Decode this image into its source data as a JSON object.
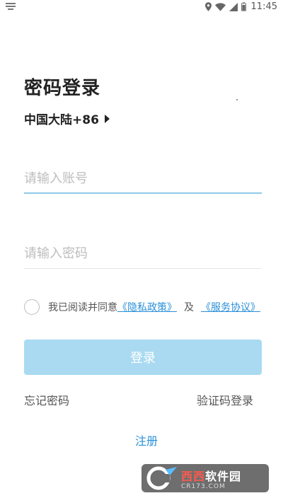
{
  "status_bar": {
    "time": "11:45",
    "icons": [
      "notification-icon",
      "location-icon",
      "wifi-icon",
      "signal-icon",
      "battery-icon"
    ]
  },
  "login": {
    "title": "密码登录",
    "region": "中国大陆+86",
    "account_placeholder": "请输入账号",
    "password_placeholder": "请输入密码",
    "agree_prefix": "我已阅读并同意",
    "privacy_link": "《隐私政策》",
    "and_text": "及",
    "service_link": "《服务协议》",
    "login_button": "登录",
    "forgot_password": "忘记密码",
    "code_login": "验证码登录",
    "register": "注册"
  },
  "watermark": {
    "main_red": "西西",
    "main_white": "软件园",
    "sub": "CR173.COM"
  },
  "colors": {
    "accent": "#2a8fd9",
    "button_disabled": "#a9daf1",
    "input_active_line": "#8ec9e8"
  }
}
